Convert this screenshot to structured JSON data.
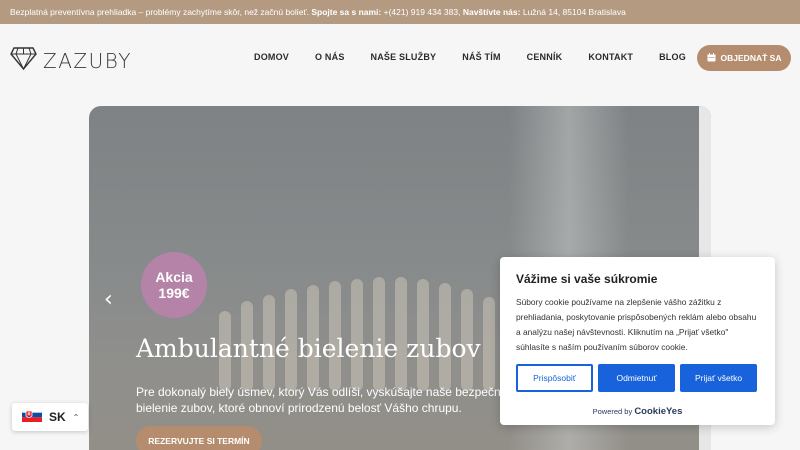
{
  "topbar": {
    "text": "Bezplatná preventívna prehliadka – problémy zachytíme skôr, než začnú bolieť.",
    "phone_label": "Spojte sa s nami:",
    "phone": "+(421) 919 434 383,",
    "visit_label": "Navštívte nás:",
    "address": "Lužná 14, 85104 Bratislava"
  },
  "header": {
    "logo_text": "ZAZUBY",
    "logo_icon": "tooth-diamond-icon",
    "nav": [
      {
        "label": "DOMOV"
      },
      {
        "label": "O NÁS"
      },
      {
        "label": "NAŠE SLUŽBY"
      },
      {
        "label": "NÁŠ TÍM"
      },
      {
        "label": "CENNÍK"
      },
      {
        "label": "KONTAKT"
      },
      {
        "label": "BLOG"
      }
    ],
    "order_button": "OBJEDNAŤ SA",
    "order_icon": "calendar-icon"
  },
  "hero": {
    "promo_line1": "Akcia",
    "promo_line2": "199€",
    "title": "Ambulantné bielenie zubov",
    "text": "Pre dokonalý biely úsmev, ktorý Vás odlíši, vyskúšajte naše bezpečné bielenie zubov, ktoré obnoví prirodzenú belosť Vášho chrupu.",
    "cta": "REZERVUJTE SI TERMÍN",
    "arrow_icon": "chevron-left-icon"
  },
  "cookie": {
    "title": "Vážime si vaše súkromie",
    "text": "Súbory cookie používame na zlepšenie vášho zážitku z prehliadania, poskytovanie prispôsobených reklám alebo obsahu a analýzu našej návštevnosti. Kliknutím na „Prijať všetko\" súhlasíte s naším používaním súborov cookie.",
    "btn_customize": "Prispôsobiť",
    "btn_reject": "Odmietnuť",
    "btn_accept": "Prijať všetko",
    "powered_by": "Powered by",
    "brand": "CookieYes"
  },
  "language": {
    "code": "SK",
    "flag_icon": "slovakia-flag-icon",
    "caret_icon": "chevron-up-icon"
  },
  "colors": {
    "topbar": "#b59a82",
    "accent_brown": "#b58d6e",
    "promo_purple": "#b583a8",
    "cookie_blue": "#1863dc"
  }
}
